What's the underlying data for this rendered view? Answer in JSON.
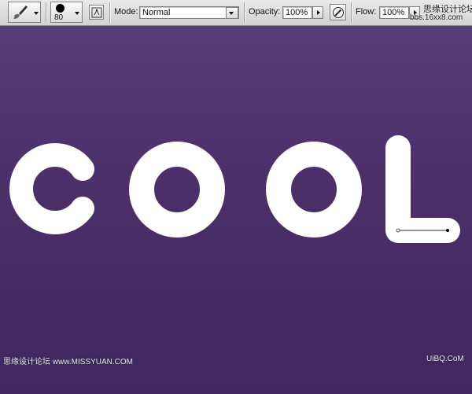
{
  "toolbar": {
    "brush_size": "80",
    "mode_label": "Mode:",
    "mode_value": "Normal",
    "opacity_label": "Opacity:",
    "opacity_value": "100%",
    "flow_label": "Flow:",
    "flow_value": "100%"
  },
  "canvas": {
    "letters": [
      "C",
      "O",
      "O",
      "L"
    ],
    "background_top": "#573b77",
    "background_bottom": "#3f2760",
    "text_color": "#ffffff"
  },
  "watermarks": {
    "top_right_1": "思缘设计论坛",
    "top_right_2": "bbs.16xx8.com",
    "bottom_left": "思缘设计论坛 www.MISSYUAN.COM",
    "bottom_right": "UiBQ.CoM"
  },
  "icons": [
    "brush-icon",
    "brush-tip-icon",
    "brush-panel-icon",
    "airbrush-icon"
  ]
}
